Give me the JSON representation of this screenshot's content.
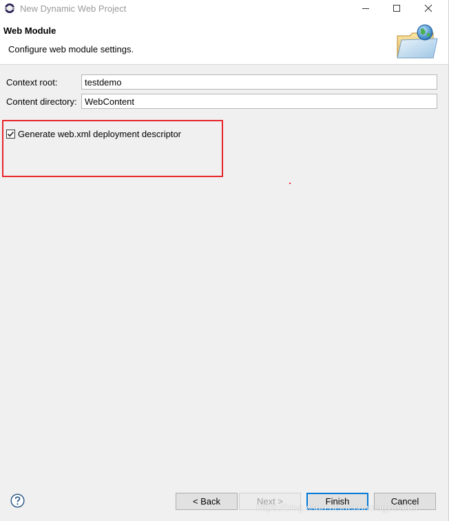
{
  "window": {
    "title": "New Dynamic Web Project",
    "app_icon": "eclipse-icon"
  },
  "banner": {
    "title": "Web Module",
    "description": "Configure web module settings.",
    "graphic": "web-folder-globe-icon"
  },
  "form": {
    "context_root": {
      "label": "Context root:",
      "value": "testdemo"
    },
    "content_directory": {
      "label": "Content directory:",
      "value": "WebContent"
    },
    "generate_web_xml": {
      "label": "Generate web.xml deployment descriptor",
      "checked": true
    }
  },
  "buttons": {
    "back": "< Back",
    "next": "Next >",
    "finish": "Finish",
    "cancel": "Cancel"
  },
  "watermark": "https://blog.csdn.net/technologyleader",
  "colors": {
    "highlight": "#e8232b",
    "default_button_border": "#0078d7"
  }
}
